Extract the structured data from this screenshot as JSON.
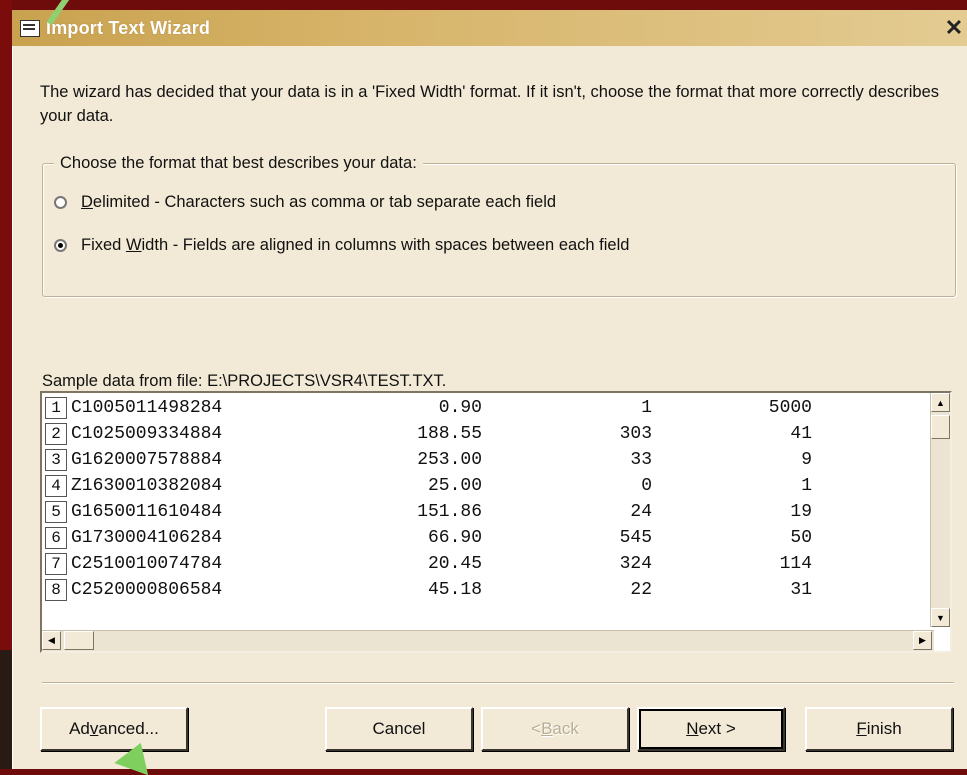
{
  "window": {
    "title": "Import Text Wizard",
    "close_glyph": "✕",
    "icon": "table-icon"
  },
  "intro": {
    "text": "The wizard has decided that your data is in a 'Fixed Width' format.  If it isn't, choose the format that more correctly describes your data."
  },
  "format_group": {
    "legend": "Choose the format that best describes your data:",
    "options": [
      {
        "accel": "D",
        "label_rest": "elimited - Characters such as comma or tab separate each field",
        "checked": false
      },
      {
        "pre": "Fixed ",
        "accel": "W",
        "label_rest": "idth - Fields are aligned in columns with spaces between each field",
        "checked": true
      }
    ]
  },
  "sample": {
    "label": "Sample data from file: E:\\PROJECTS\\VSR4\\TEST.TXT.",
    "rows": [
      {
        "n": "1",
        "c1": "C1005011498284",
        "c2": "0.90",
        "c3": "1",
        "c4": "5000"
      },
      {
        "n": "2",
        "c1": "C1025009334884",
        "c2": "188.55",
        "c3": "303",
        "c4": "41"
      },
      {
        "n": "3",
        "c1": "G1620007578884",
        "c2": "253.00",
        "c3": "33",
        "c4": "9"
      },
      {
        "n": "4",
        "c1": "Z1630010382084",
        "c2": "25.00",
        "c3": "0",
        "c4": "1"
      },
      {
        "n": "5",
        "c1": "G1650011610484",
        "c2": "151.86",
        "c3": "24",
        "c4": "19"
      },
      {
        "n": "6",
        "c1": "G1730004106284",
        "c2": "66.90",
        "c3": "545",
        "c4": "50"
      },
      {
        "n": "7",
        "c1": "C2510010074784",
        "c2": "20.45",
        "c3": "324",
        "c4": "114"
      },
      {
        "n": "8",
        "c1": "C2520000806584",
        "c2": "45.18",
        "c3": "22",
        "c4": "31"
      }
    ]
  },
  "buttons": {
    "advanced_pre": "Ad",
    "advanced_accel": "v",
    "advanced_rest": "anced...",
    "cancel": "Cancel",
    "back_pre": "< ",
    "back_accel": "B",
    "back_rest": "ack",
    "next_accel": "N",
    "next_rest": "ext >",
    "finish_accel": "F",
    "finish_rest": "inish"
  },
  "colors": {
    "slide_bg": "#6e0b0b",
    "dialog_bg": "#f2ead6",
    "titlebar": "#c9a24f",
    "callout": "#7fcf5f"
  }
}
